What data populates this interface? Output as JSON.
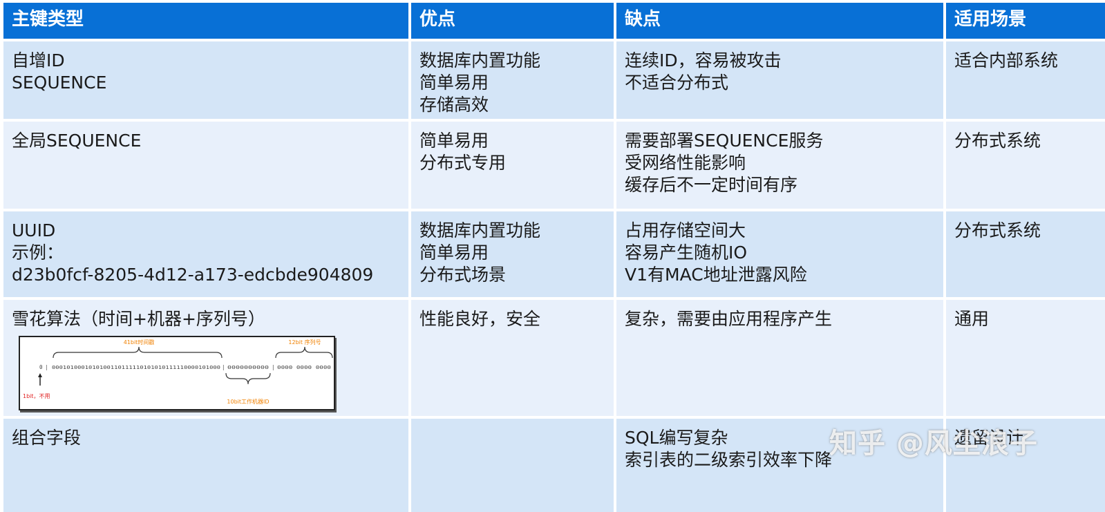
{
  "headers": [
    "主键类型",
    "优点",
    "缺点",
    "适用场景"
  ],
  "rows": [
    {
      "type": [
        "自增ID",
        "SEQUENCE"
      ],
      "pros": [
        "数据库内置功能",
        "简单易用",
        "存储高效"
      ],
      "cons": [
        "连续ID，容易被攻击",
        "不适合分布式"
      ],
      "scene": [
        "适合内部系统"
      ]
    },
    {
      "type": [
        "全局SEQUENCE"
      ],
      "pros": [
        "简单易用",
        "分布式专用"
      ],
      "cons": [
        "需要部署SEQUENCE服务",
        "受网络性能影响",
        "缓存后不一定时间有序"
      ],
      "scene": [
        "分布式系统"
      ]
    },
    {
      "type": [
        "UUID",
        "示例：",
        "d23b0fcf-8205-4d12-a173-edcbde904809"
      ],
      "pros": [
        "数据库内置功能",
        "简单易用",
        "分布式场景"
      ],
      "cons": [
        "占用存储空间大",
        "容易产生随机IO",
        "V1有MAC地址泄露风险"
      ],
      "scene": [
        "分布式系统"
      ]
    },
    {
      "type": [
        "雪花算法（时间+机器+序列号）"
      ],
      "pros": [
        "性能良好，安全"
      ],
      "cons": [
        "复杂，需要由应用程序产生"
      ],
      "scene": [
        "通用"
      ]
    },
    {
      "type": [
        "组合字段"
      ],
      "pros": [],
      "cons": [
        "SQL编写复杂",
        "索引表的二级索引效率下降"
      ],
      "scene": [
        "遗留设计"
      ]
    }
  ],
  "snowflake_diagram": {
    "label_time": "41bit时间戳",
    "label_seq": "12bit 序列号",
    "label_sign": "1bit，不用",
    "label_machine": "10bit工作机器ID",
    "bits_sign": "0",
    "bits_time": "0001010001010100110111110101010111110000101000",
    "bits_machine": "0000000000",
    "bits_seq": "0000 0000 0000"
  },
  "watermark": "知乎 @风尘浪子",
  "colors": {
    "header": "#0870d6",
    "row_dark": "#d4e5f7",
    "row_light": "#e8f0fb",
    "diagram_accent": "#f08000"
  }
}
